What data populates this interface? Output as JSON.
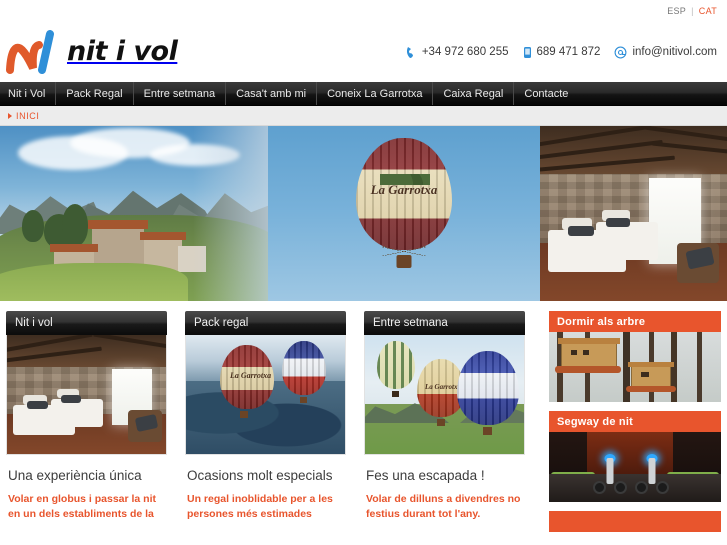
{
  "topbar": {
    "lang_esp": "ESP",
    "lang_sep": "|",
    "lang_cat": "CAT"
  },
  "header": {
    "logo_word": "nit i vol",
    "logo_mark_orange": "#e05a2b",
    "logo_mark_blue": "#2f8fd8",
    "contacts": [
      {
        "icon": "phone-icon",
        "text": "+34 972 680 255"
      },
      {
        "icon": "mobile-icon",
        "text": "689 471 872"
      },
      {
        "icon": "at-icon",
        "text": "info@nitivol.com"
      }
    ]
  },
  "nav": {
    "items": [
      {
        "label": "Nit i Vol"
      },
      {
        "label": "Pack Regal"
      },
      {
        "label": "Entre setmana"
      },
      {
        "label": "Casa't amb mi"
      },
      {
        "label": "Coneix La Garrotxa"
      },
      {
        "label": "Caixa Regal"
      },
      {
        "label": "Contacte"
      }
    ]
  },
  "breadcrumb": {
    "item": "INICI"
  },
  "hero": {
    "balloon_label": "La Garrotxa",
    "alt_left": "Masia de pedra amb muntanyes de La Garrotxa",
    "alt_mid": "Globus aerostatic La Garrotxa en vol",
    "alt_right": "Habitacio rustica amb parets de pedra i bigues de fusta"
  },
  "cards": [
    {
      "head": "Nit i vol",
      "title": "Una experiència única",
      "desc": "Volar en globus i passar la nit en un dels establiments de la",
      "image_alt": "Habitacio rustica amb dos llits"
    },
    {
      "head": "Pack regal",
      "title": "Ocasions molt especials",
      "desc": "Un regal inoblidable per a les persones més estimades",
      "image_alt": "Dos globus volant sobre el paisatge"
    },
    {
      "head": "Entre setmana",
      "title": "Fes una escapada !",
      "desc": "Volar de dilluns a divendres no festius durant tot l'any.",
      "image_alt": "Tres globus en un camp verd"
    }
  ],
  "sidebar": {
    "boxes": [
      {
        "head": "Dormir als arbre",
        "image_alt": "Cabanes als arbres al bosc de pins"
      },
      {
        "head": "Segway de nit",
        "image_alt": "Segways il·luminats de nit"
      },
      {
        "head": "",
        "image_alt": ""
      }
    ]
  },
  "colors": {
    "accent_orange": "#e8552d",
    "link_blue": "#2f8fd8",
    "nav_dark": "#1a1a1a",
    "crumb_bg": "#ececec"
  }
}
